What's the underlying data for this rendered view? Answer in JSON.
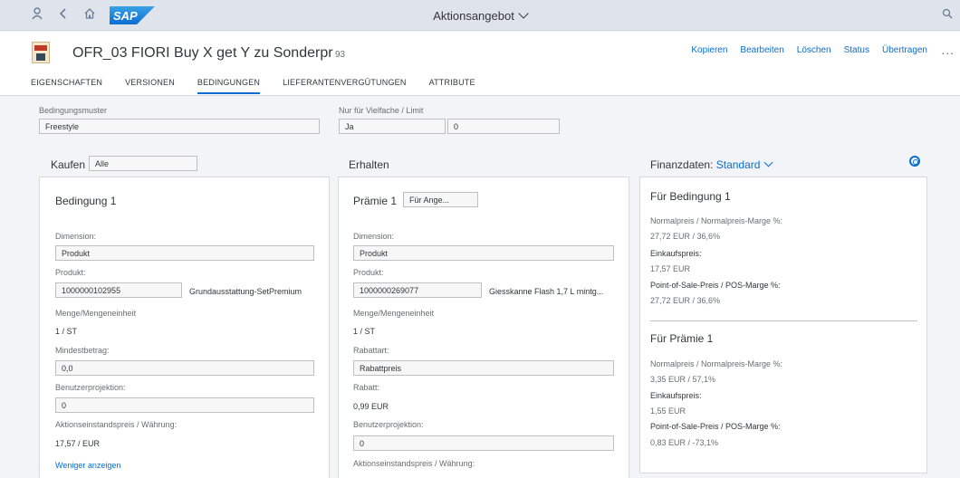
{
  "shell": {
    "title": "Aktionsangebot",
    "logo_text": "SAP",
    "icons": [
      "user-icon",
      "back-icon",
      "home-icon",
      "search-icon"
    ]
  },
  "header": {
    "title": "OFR_03 FIORI Buy X get Y zu Sonderpr",
    "count": "93",
    "actions": [
      "Kopieren",
      "Bearbeiten",
      "Löschen",
      "Status",
      "Übertragen"
    ],
    "more": "..."
  },
  "tabs": [
    "EIGENSCHAFTEN",
    "VERSIONEN",
    "BEDINGUNGEN",
    "LIEFERANTENVERGÜTUNGEN",
    "ATTRIBUTE"
  ],
  "active_tab": "BEDINGUNGEN",
  "form": {
    "muster_label": "Bedingungsmuster",
    "muster_value": "Freestyle",
    "vielfache_label": "Nur für Vielfache / Limit",
    "vielfache_value": "Ja",
    "limit_value": "0"
  },
  "kaufen": {
    "title": "Kaufen",
    "select": "Alle",
    "card_title": "Bedingung 1",
    "dimension_label": "Dimension:",
    "dimension_value": "Produkt",
    "produkt_label": "Produkt:",
    "produkt_id": "1000000102955",
    "produkt_name": "Grundausstattung-SetPremium",
    "menge_label": "Menge/Mengeneinheit",
    "menge_value": "1 / ST",
    "mindest_label": "Mindestbetrag:",
    "mindest_value": "0,0",
    "benutzer_label": "Benutzerprojektion:",
    "benutzer_value": "0",
    "aktion_label": "Aktionseinstandspreis / Währung:",
    "aktion_value": "17,57 / EUR",
    "less_link": "Weniger anzeigen"
  },
  "erhalten": {
    "title": "Erhalten",
    "card_title": "Prämie 1",
    "select": "Für Ange...",
    "dimension_label": "Dimension:",
    "dimension_value": "Produkt",
    "produkt_label": "Produkt:",
    "produkt_id": "1000000269077",
    "produkt_name": "Giesskanne Flash 1,7 L mintg...",
    "menge_label": "Menge/Mengeneinheit",
    "menge_value": "1 / ST",
    "rabattart_label": "Rabattart:",
    "rabattart_value": "Rabattpreis",
    "rabatt_label": "Rabatt:",
    "rabatt_value": "0,99 EUR",
    "benutzer_label": "Benutzerprojektion:",
    "benutzer_value": "0",
    "aktion_label": "Aktionseinstandspreis / Währung:"
  },
  "finanz": {
    "title": "Finanzdaten:",
    "variant": "Standard",
    "b1": {
      "title": "Für Bedingung 1",
      "normal_label": "Normalpreis / Normalpreis-Marge %:",
      "normal_value": "27,72 EUR / 36,6%",
      "ek_label": "Einkaufspreis:",
      "ek_value": "17,57 EUR",
      "pos_label": "Point-of-Sale-Preis / POS-Marge %:",
      "pos_value": "27,72 EUR / 36,6%"
    },
    "p1": {
      "title": "Für Prämie 1",
      "normal_label": "Normalpreis / Normalpreis-Marge %:",
      "normal_value": "3,35 EUR / 57,1%",
      "ek_label": "Einkaufspreis:",
      "ek_value": "1,55 EUR",
      "pos_label": "Point-of-Sale-Preis / POS-Marge %:",
      "pos_value": "0,83 EUR / -73,1%"
    }
  }
}
